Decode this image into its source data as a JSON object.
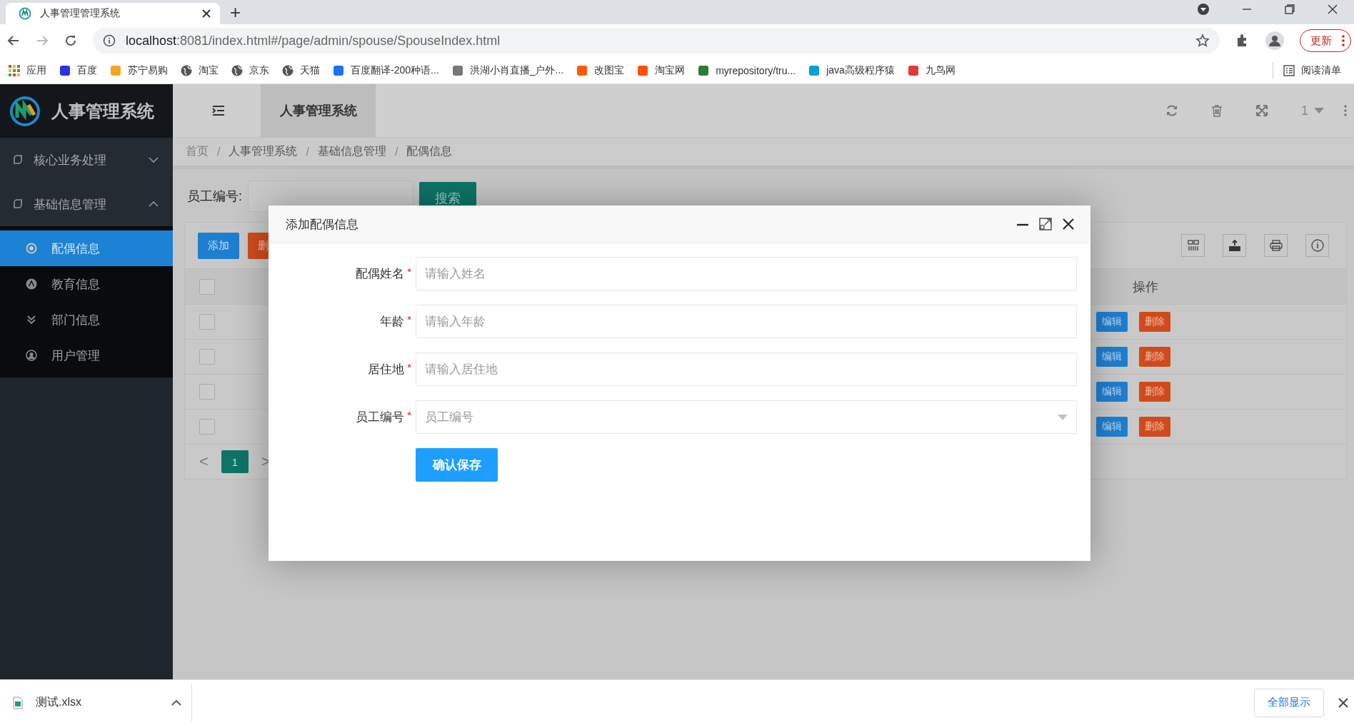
{
  "browser": {
    "tab_title": "人事管理管理系统",
    "new_tab": "+",
    "url_host": "localhost",
    "url_rest": ":8081/index.html#/page/admin/spouse/SpouseIndex.html",
    "update_button": "更新",
    "bookmarks": [
      {
        "label": "应用"
      },
      {
        "label": "百度"
      },
      {
        "label": "苏宁易购"
      },
      {
        "label": "淘宝"
      },
      {
        "label": "京东"
      },
      {
        "label": "天猫"
      },
      {
        "label": "百度翻译-200种语..."
      },
      {
        "label": "洪湖小肖直播_户外..."
      },
      {
        "label": "改图宝"
      },
      {
        "label": "淘宝网"
      },
      {
        "label": "myrepository/tru..."
      },
      {
        "label": "java高级程序猿"
      },
      {
        "label": "九鸟网"
      }
    ],
    "reading_list": "阅读清单"
  },
  "app": {
    "logo_title": "人事管理系统",
    "sidebar": {
      "items": [
        {
          "label": "核心业务处理",
          "expanded": false
        },
        {
          "label": "基础信息管理",
          "expanded": true,
          "children": [
            {
              "label": "配偶信息",
              "selected": true
            },
            {
              "label": "教育信息",
              "selected": false
            },
            {
              "label": "部门信息",
              "selected": false
            },
            {
              "label": "用户管理",
              "selected": false
            }
          ]
        }
      ]
    },
    "header": {
      "tab_label": "人事管理系统",
      "page_count": "1"
    },
    "breadcrumb": [
      "首页",
      "人事管理系统",
      "基础信息管理",
      "配偶信息"
    ],
    "breadcrumb_separator": "/",
    "search": {
      "label": "员工编号:",
      "button": "搜索"
    },
    "toolbar": [
      {
        "label": "添加",
        "kind": "add"
      },
      {
        "label": "删",
        "kind": "delete"
      }
    ],
    "table": {
      "header_checked": false,
      "action_header": "操作",
      "rows": [
        {
          "checked": false,
          "actions": [
            "编辑",
            "删除"
          ]
        },
        {
          "checked": false,
          "actions": [
            "编辑",
            "删除"
          ]
        },
        {
          "checked": false,
          "actions": [
            "编辑",
            "删除"
          ]
        },
        {
          "checked": false,
          "actions": [
            "编辑",
            "删除"
          ]
        }
      ]
    },
    "pagination": {
      "prev": "<",
      "pages": [
        {
          "label": "1",
          "selected": true
        }
      ],
      "next": ">"
    }
  },
  "modal": {
    "title": "添加配偶信息",
    "required_mark": "*",
    "fields": [
      {
        "label": "配偶姓名",
        "required": true,
        "placeholder": "请输入姓名",
        "kind": "text"
      },
      {
        "label": "年龄",
        "required": true,
        "placeholder": "请输入年龄",
        "kind": "text"
      },
      {
        "label": "居住地",
        "required": true,
        "placeholder": "请输入居住地",
        "kind": "text"
      },
      {
        "label": "员工编号",
        "required": true,
        "placeholder": "员工编号",
        "kind": "select"
      }
    ],
    "submit": "确认保存"
  },
  "downloads": {
    "file": "测试.xlsx",
    "show_all": "全部显示"
  }
}
